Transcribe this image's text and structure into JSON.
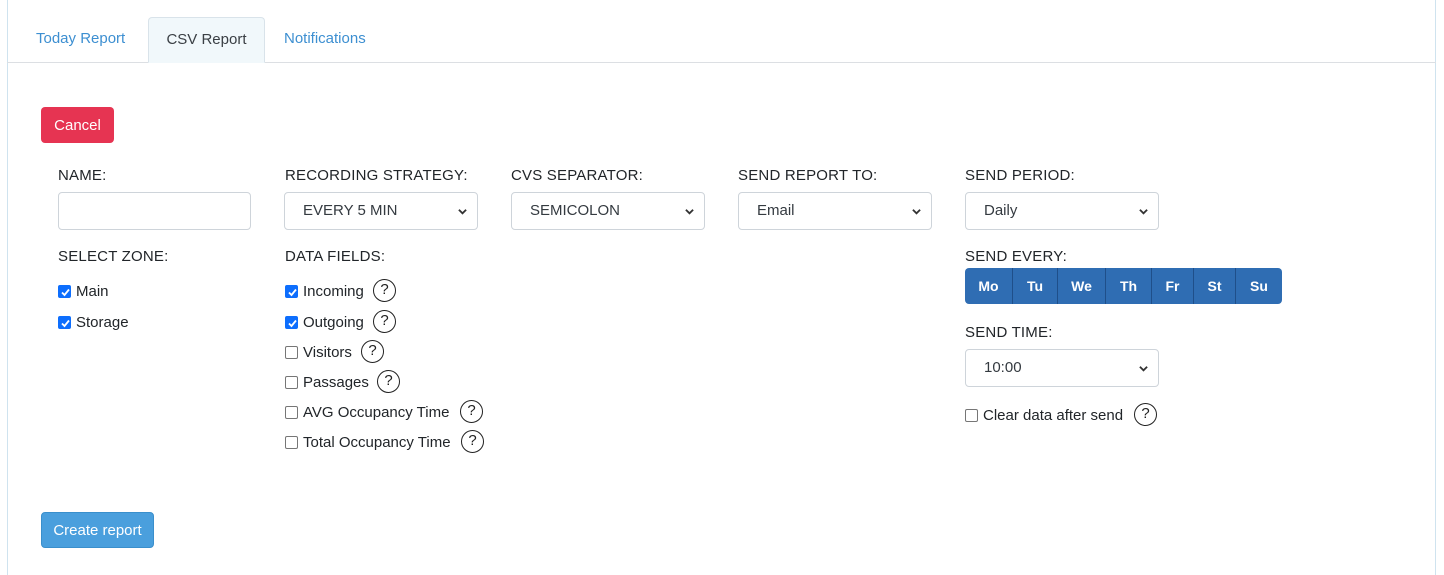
{
  "tabs": [
    {
      "label": "Today Report"
    },
    {
      "label": "CSV Report"
    },
    {
      "label": "Notifications"
    }
  ],
  "buttons": {
    "cancel": "Cancel",
    "create": "Create report"
  },
  "form": {
    "name": {
      "label": "NAME:",
      "value": ""
    },
    "recording_strategy": {
      "label": "RECORDING STRATEGY:",
      "value": "EVERY 5 MIN"
    },
    "csv_separator": {
      "label": "CVS SEPARATOR:",
      "value": "SEMICOLON"
    },
    "send_report_to": {
      "label": "SEND REPORT TO:",
      "value": "Email"
    },
    "send_period": {
      "label": "SEND PERIOD:",
      "value": "Daily"
    },
    "send_every": {
      "label": "SEND EVERY:",
      "days": [
        "Mo",
        "Tu",
        "We",
        "Th",
        "Fr",
        "St",
        "Su"
      ]
    },
    "send_time": {
      "label": "SEND TIME:",
      "value": "10:00"
    },
    "clear_data": {
      "label": "Clear data after send",
      "checked": false
    },
    "select_zone": {
      "label": "SELECT ZONE:",
      "zones": [
        {
          "label": "Main",
          "checked": true
        },
        {
          "label": "Storage",
          "checked": true
        }
      ]
    },
    "data_fields": {
      "label": "DATA FIELDS:",
      "fields": [
        {
          "label": "Incoming",
          "checked": true
        },
        {
          "label": "Outgoing",
          "checked": true
        },
        {
          "label": "Visitors",
          "checked": false
        },
        {
          "label": "Passages",
          "checked": false
        },
        {
          "label": "AVG Occupancy Time",
          "checked": false
        },
        {
          "label": "Total Occupancy Time",
          "checked": false
        }
      ]
    }
  },
  "help_glyph": "?",
  "icons": {
    "chevron": "chevron-down-icon",
    "help": "question-circle-icon",
    "check": "checkmark-icon"
  },
  "colors": {
    "cancel": "#e63452",
    "create": "#4a9fdd",
    "day_button": "#2f6db3",
    "tab_link": "#3d8fd1",
    "checkbox": "#0d6efd"
  }
}
